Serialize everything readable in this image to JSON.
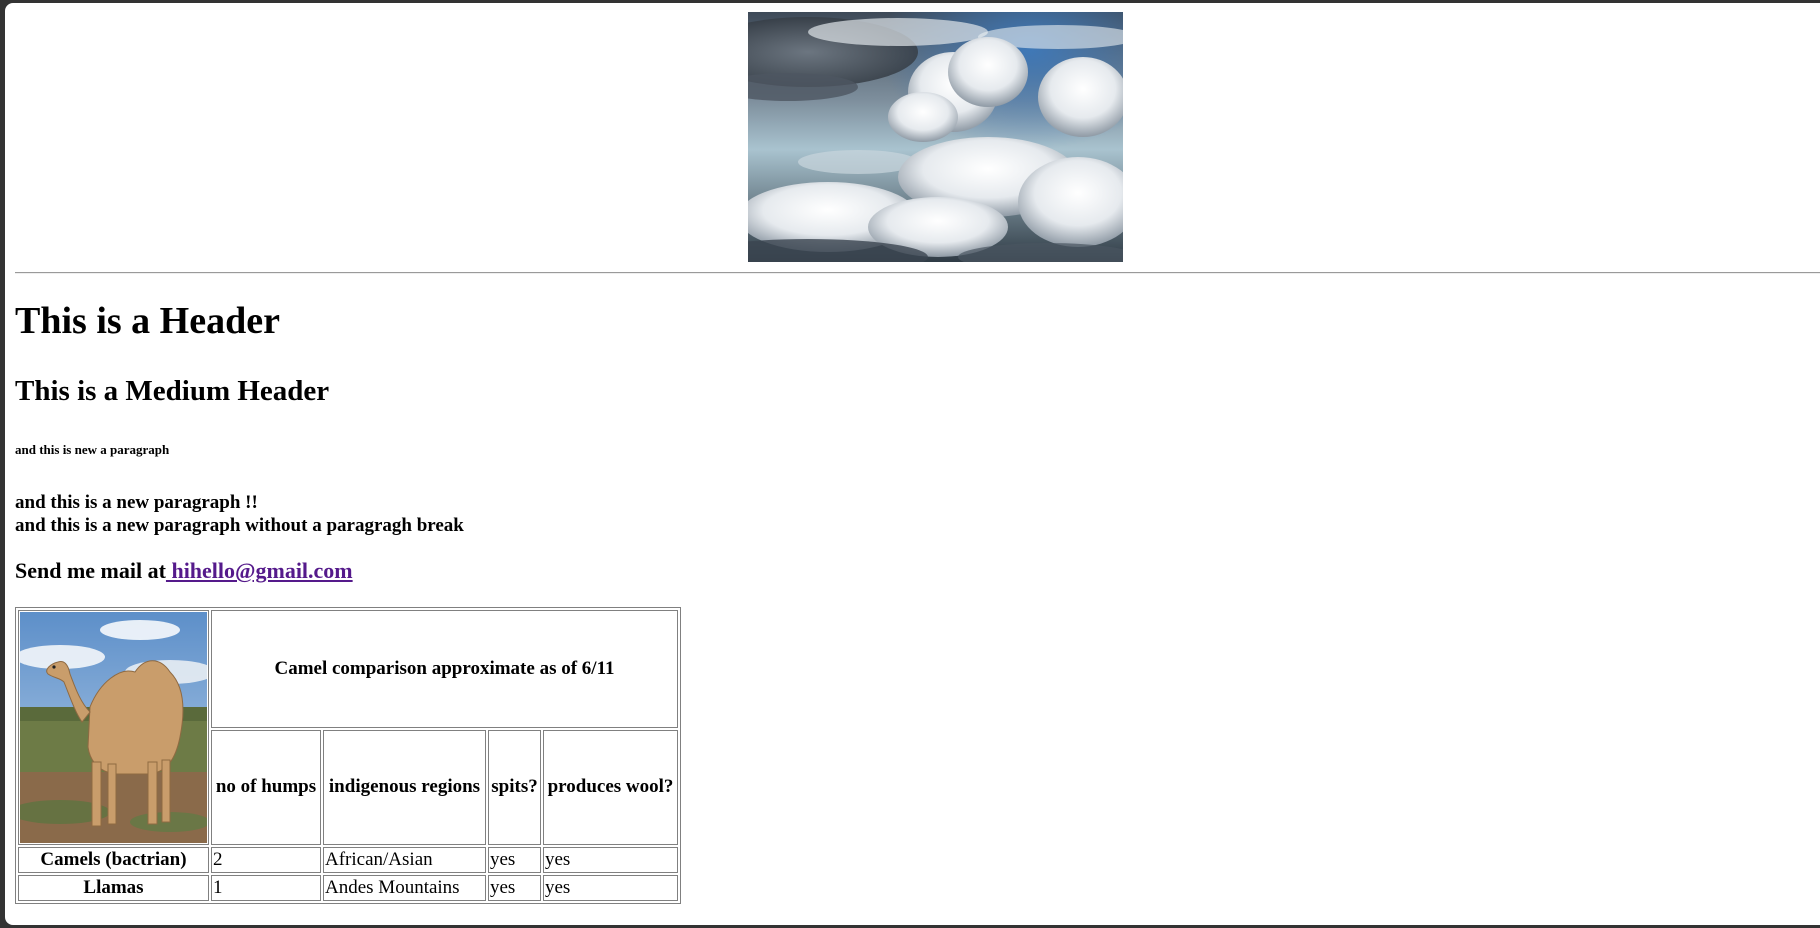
{
  "page": {
    "banner_image_alt": "cloudscape photo",
    "header": "This is a Header",
    "medium_header": "This is a Medium Header",
    "small_paragraph": "and this is new a paragraph",
    "paragraph_1": "and this is a new paragraph !!",
    "paragraph_2": "and this is a new paragraph without a paragragh break",
    "mail_prefix": "Send me mail at",
    "mail_link": " hihello@gmail.com"
  },
  "table": {
    "camel_image_alt": "dromedary camel photo",
    "caption": "Camel comparison approximate as of 6/11",
    "headers": [
      "no of humps",
      "indigenous regions",
      "spits?",
      "produces wool?"
    ],
    "rows": [
      {
        "name": "Camels (bactrian)",
        "humps": "2",
        "regions": "African/Asian",
        "spits": "yes",
        "wool": "yes"
      },
      {
        "name": "Llamas",
        "humps": "1",
        "regions": "Andes Mountains",
        "spits": "yes",
        "wool": "yes"
      }
    ]
  },
  "colors": {
    "link_visited": "#551a8b",
    "rule": "#9a9a9a",
    "table_border": "#808080"
  }
}
